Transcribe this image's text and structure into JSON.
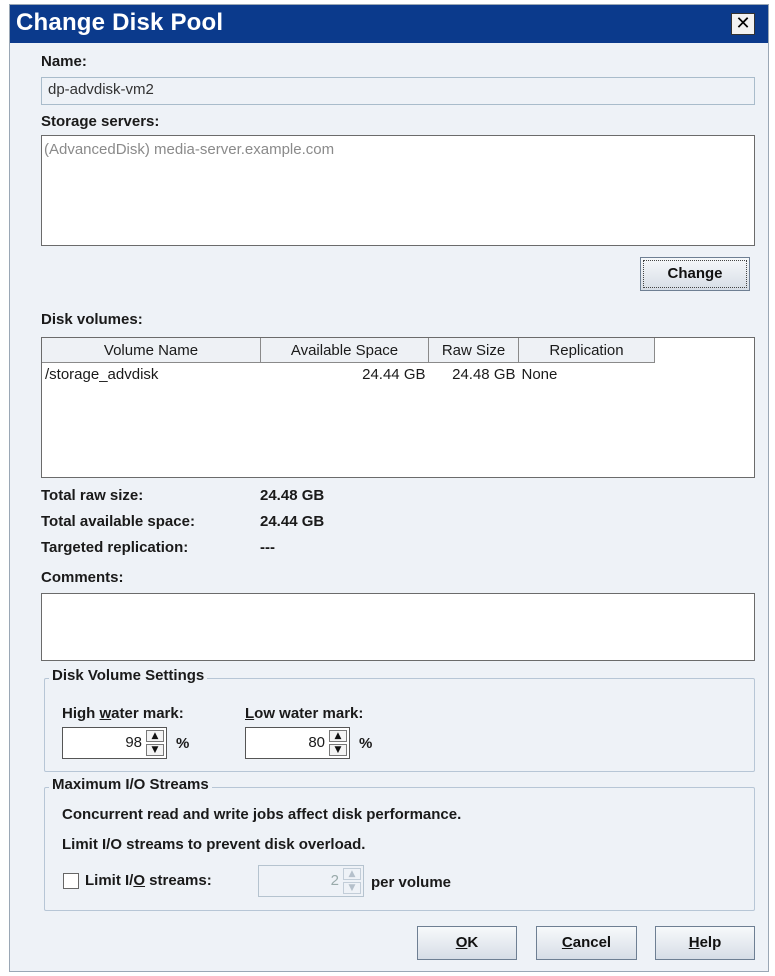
{
  "window": {
    "title": "Change Disk Pool",
    "close_symbol": "✕"
  },
  "name": {
    "label": "Name:",
    "value": "dp-advdisk-vm2"
  },
  "storage_servers": {
    "label": "Storage servers:",
    "items": [
      "(AdvancedDisk) media-server.example.com"
    ],
    "change_button": "Change"
  },
  "disk_volumes": {
    "label": "Disk volumes:",
    "columns": [
      "Volume Name",
      "Available Space",
      "Raw Size",
      "Replication"
    ],
    "rows": [
      {
        "volume_name": "/storage_advdisk",
        "available_space": "24.44 GB",
        "raw_size": "24.48 GB",
        "replication": "None"
      }
    ]
  },
  "summary": {
    "total_raw_size_label": "Total raw size:",
    "total_raw_size": "24.48 GB",
    "total_available_label": "Total available space:",
    "total_available": "24.44 GB",
    "targeted_replication_label": "Targeted replication:",
    "targeted_replication": "---"
  },
  "comments": {
    "label": "Comments:",
    "value": ""
  },
  "volume_settings": {
    "legend": "Disk Volume Settings",
    "high_label_pre": "High ",
    "high_label_key": "w",
    "high_label_post": "ater mark:",
    "high_value": "98",
    "low_label_pre": "",
    "low_label_key": "L",
    "low_label_post": "ow water mark:",
    "low_value": "80",
    "unit": "%"
  },
  "io_streams": {
    "legend": "Maximum I/O Streams",
    "line1": "Concurrent read and write jobs affect disk performance.",
    "line2": "Limit I/O streams to prevent disk overload.",
    "limit_label_pre": "Limit I/",
    "limit_label_key": "O",
    "limit_label_post": " streams:",
    "limit_checked": false,
    "limit_value": "2",
    "per_volume": "per volume"
  },
  "buttons": {
    "ok_key": "O",
    "ok_post": "K",
    "cancel_key": "C",
    "cancel_post": "ancel",
    "help_key": "H",
    "help_post": "elp"
  },
  "colors": {
    "titlebar": "#0b3a8c",
    "dialog_bg": "#eef2f7"
  }
}
